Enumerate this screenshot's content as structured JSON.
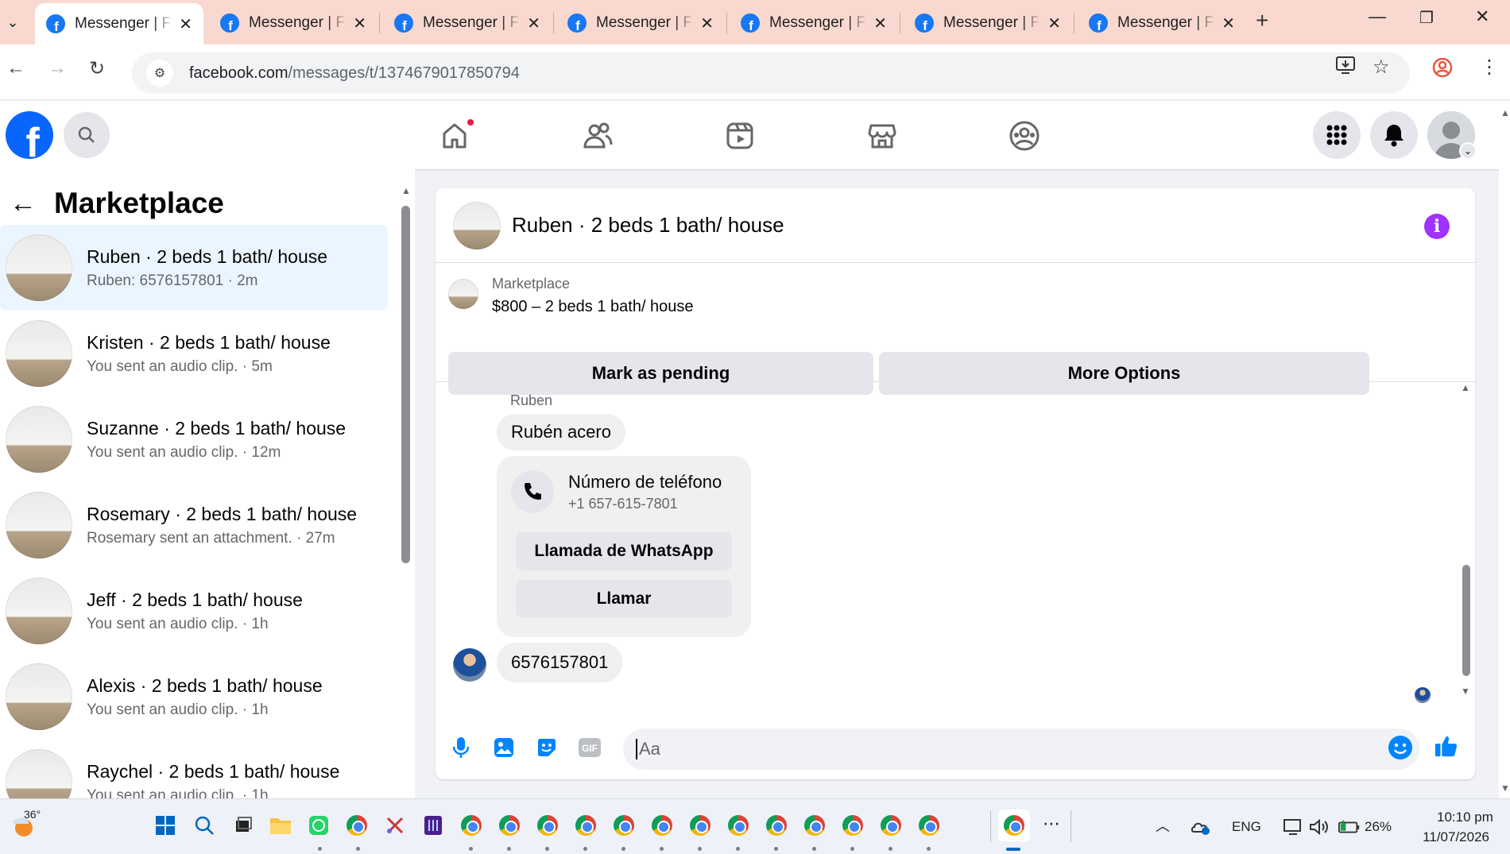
{
  "browser": {
    "tabs": [
      {
        "title": "Messenger | Facebook",
        "active": true
      },
      {
        "title": "Messenger | Facebook",
        "active": false
      },
      {
        "title": "Messenger | Facebook",
        "active": false
      },
      {
        "title": "Messenger | Facebook",
        "active": false
      },
      {
        "title": "Messenger | Facebook",
        "active": false
      },
      {
        "title": "Messenger | Facebook",
        "active": false
      },
      {
        "title": "Messenger | Facebook",
        "active": false
      }
    ],
    "url_domain": "facebook.com",
    "url_path": "/messages/t/1374679017850794"
  },
  "marketplace": {
    "title": "Marketplace",
    "conversations": [
      {
        "name": "Ruben · 2 beds 1 bath/ house",
        "preview": "Ruben: 6576157801 · 2m",
        "selected": true
      },
      {
        "name": "Kristen · 2 beds 1 bath/ house",
        "preview": "You sent an audio clip. · 5m",
        "selected": false
      },
      {
        "name": "Suzanne · 2 beds 1 bath/ house",
        "preview": "You sent an audio clip. · 12m",
        "selected": false
      },
      {
        "name": "Rosemary · 2 beds 1 bath/ house",
        "preview": "Rosemary sent an attachment. · 27m",
        "selected": false
      },
      {
        "name": "Jeff · 2 beds 1 bath/ house",
        "preview": "You sent an audio clip. · 1h",
        "selected": false
      },
      {
        "name": "Alexis · 2 beds 1 bath/ house",
        "preview": "You sent an audio clip. · 1h",
        "selected": false
      },
      {
        "name": "Raychel · 2 beds 1 bath/ house",
        "preview": "You sent an audio clip. · 1h",
        "selected": false
      }
    ]
  },
  "chat": {
    "header_name": "Ruben · 2 beds 1 bath/ house",
    "listing_caption": "Marketplace",
    "listing_price": "$800 – 2 beds 1 bath/ house",
    "mark_pending": "Mark as pending",
    "more_options": "More Options",
    "sender_label": "Ruben",
    "message_1": "Rubén acero",
    "phone_card_title": "Número de teléfono",
    "phone_card_number": "+1 657-615-7801",
    "whatsapp_button": "Llamada de WhatsApp",
    "call_button": "Llamar",
    "message_2": "6576157801",
    "composer_placeholder": "Aa"
  },
  "taskbar": {
    "weather_temp": "36°",
    "language": "ENG",
    "battery": "26%",
    "time": "10:10 pm",
    "date": "11/07/2026"
  },
  "colors": {
    "facebook_blue": "#0866ff",
    "messenger_blue": "#0084ff",
    "selected_row": "#ebf5ff",
    "info_purple": "#a033ff",
    "tab_strip": "#f9d9cf"
  }
}
